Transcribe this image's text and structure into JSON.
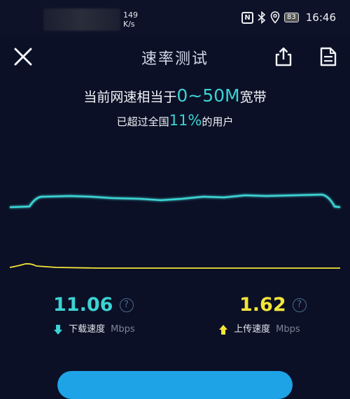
{
  "status_bar": {
    "net_speed_value": "149",
    "net_speed_unit": "K/s",
    "battery": "83",
    "time": "16:46",
    "icons": [
      "nfc-icon",
      "bluetooth-icon",
      "location-icon",
      "battery-icon"
    ]
  },
  "header": {
    "title": "速率测试",
    "icons": [
      "close-icon",
      "share-icon",
      "document-icon"
    ]
  },
  "summary": {
    "line1_prefix": "当前网速相当于",
    "line1_highlight": "0~50M",
    "line1_suffix": "宽带",
    "line2_prefix": "已超过全国",
    "line2_highlight": "11%",
    "line2_suffix": "的用户"
  },
  "download": {
    "value": "11.06",
    "label": "下载速度",
    "unit": "Mbps",
    "color": "#3cd3d3"
  },
  "upload": {
    "value": "1.62",
    "label": "上传速度",
    "unit": "Mbps",
    "color": "#f3e43a"
  },
  "colors": {
    "background": "#0b1026",
    "accent_cyan": "#3cd3d3",
    "accent_yellow": "#f3e43a",
    "button_blue": "#1ea3e6"
  }
}
